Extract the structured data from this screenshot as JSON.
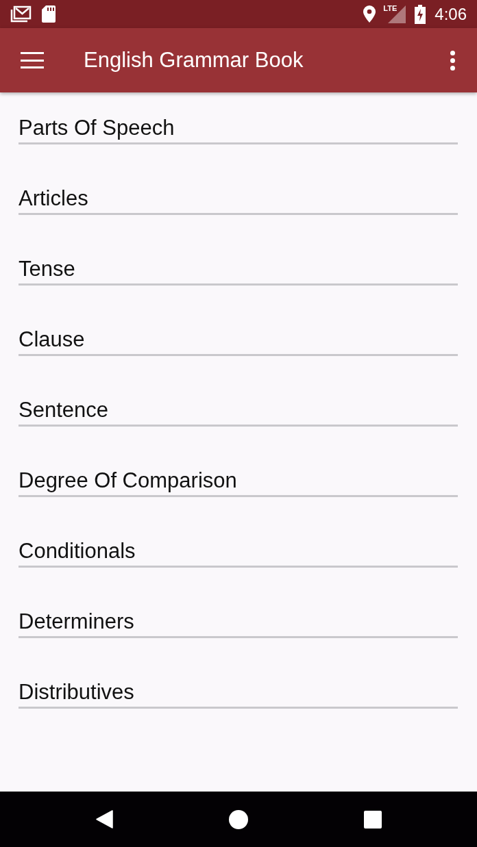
{
  "status_bar": {
    "network": "LTE",
    "time": "4:06"
  },
  "app_bar": {
    "title": "English Grammar Book"
  },
  "topics": [
    {
      "label": "Parts Of Speech"
    },
    {
      "label": "Articles"
    },
    {
      "label": "Tense"
    },
    {
      "label": "Clause"
    },
    {
      "label": "Sentence"
    },
    {
      "label": "Degree Of Comparison"
    },
    {
      "label": "Conditionals"
    },
    {
      "label": "Determiners"
    },
    {
      "label": "Distributives"
    }
  ]
}
